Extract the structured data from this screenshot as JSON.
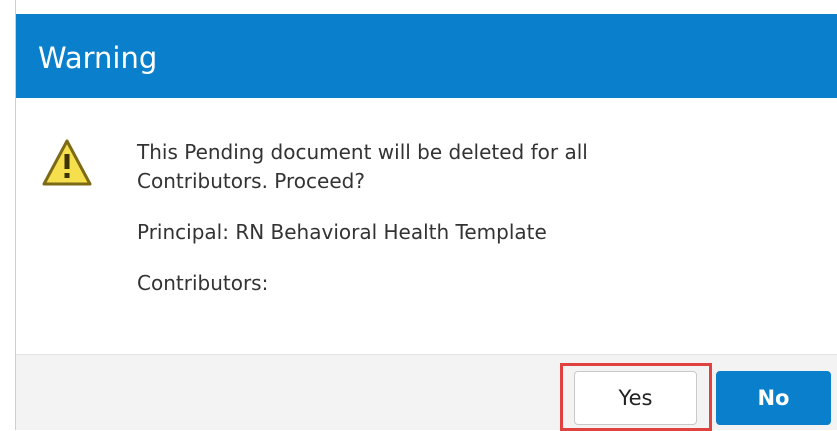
{
  "dialog": {
    "title": "Warning",
    "icon": "warning-icon",
    "message_line1": "This Pending document will be deleted for all",
    "message_line2": "Contributors. Proceed?",
    "principal_text": "Principal: RN Behavioral Health Template",
    "contributors_text": "Contributors:"
  },
  "buttons": {
    "yes_label": "Yes",
    "no_label": "No"
  },
  "colors": {
    "header_blue": "#0a7fcb",
    "highlight_red": "#e0433f",
    "warning_yellow": "#f5df4d"
  }
}
